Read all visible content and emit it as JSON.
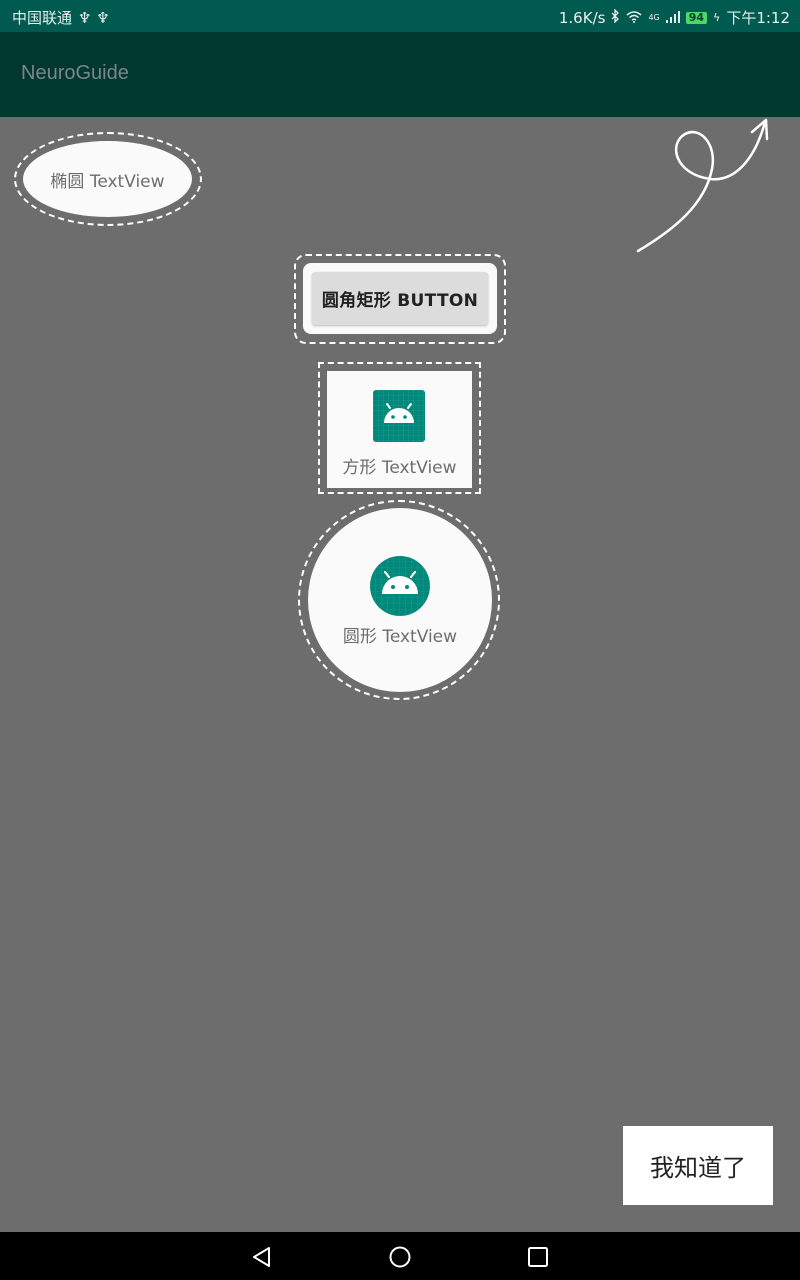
{
  "status_bar": {
    "carrier": "中国联通",
    "usb_icons": "♆ ♆",
    "network_speed": "1.6K/s",
    "network_type": "4G",
    "battery_level": "94",
    "time": "下午1:12"
  },
  "app_bar": {
    "title": "NeuroGuide"
  },
  "guide": {
    "ellipse_label": "椭圆 TextView",
    "rounded_button_label": "圆角矩形 BUTTON",
    "square_label": "方形 TextView",
    "circle_label": "圆形 TextView",
    "got_it_label": "我知道了"
  },
  "colors": {
    "overlay": "#6d6d6d",
    "status_bar": "#005a4f",
    "app_bar": "#00372f",
    "icon_teal": "#00897b"
  },
  "icons": {
    "square": "android-launcher-icon",
    "circle": "android-launcher-icon",
    "hint": "curly-arrow-icon",
    "nav_back": "triangle-back-icon",
    "nav_home": "circle-home-icon",
    "nav_recents": "square-recents-icon"
  }
}
